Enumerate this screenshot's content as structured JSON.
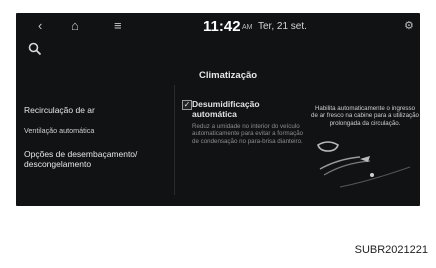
{
  "topbar": {
    "back_icon": "back-arrow-icon",
    "home_icon": "home-icon",
    "menu_icon": "menu-icon",
    "time": "11:42",
    "ampm": "AM",
    "date": "Ter, 21 set.",
    "settings_icon": "settings-icon"
  },
  "search": {
    "icon": "search-icon"
  },
  "page": {
    "title": "Climatização"
  },
  "menu": {
    "items": [
      {
        "label": "Recirculação de ar"
      },
      {
        "label": "Ventilação automática"
      },
      {
        "label": "Opções de desembaçamento/ descongelamento"
      }
    ]
  },
  "option": {
    "checked": true,
    "label": "Desumidificação automática",
    "description": "Reduz a umidade no interior do veículo automaticamente para evitar a formação de condensação no para-brisa dianteiro."
  },
  "info": {
    "text": "Habilita automaticamente o ingresso de ar fresco na cabine para a utilização prolongada da circulação."
  },
  "caption": "SUBR2021221",
  "colors": {
    "screen_bg": "#111214",
    "text": "#e6e6e6",
    "muted": "#8c8c8c"
  }
}
